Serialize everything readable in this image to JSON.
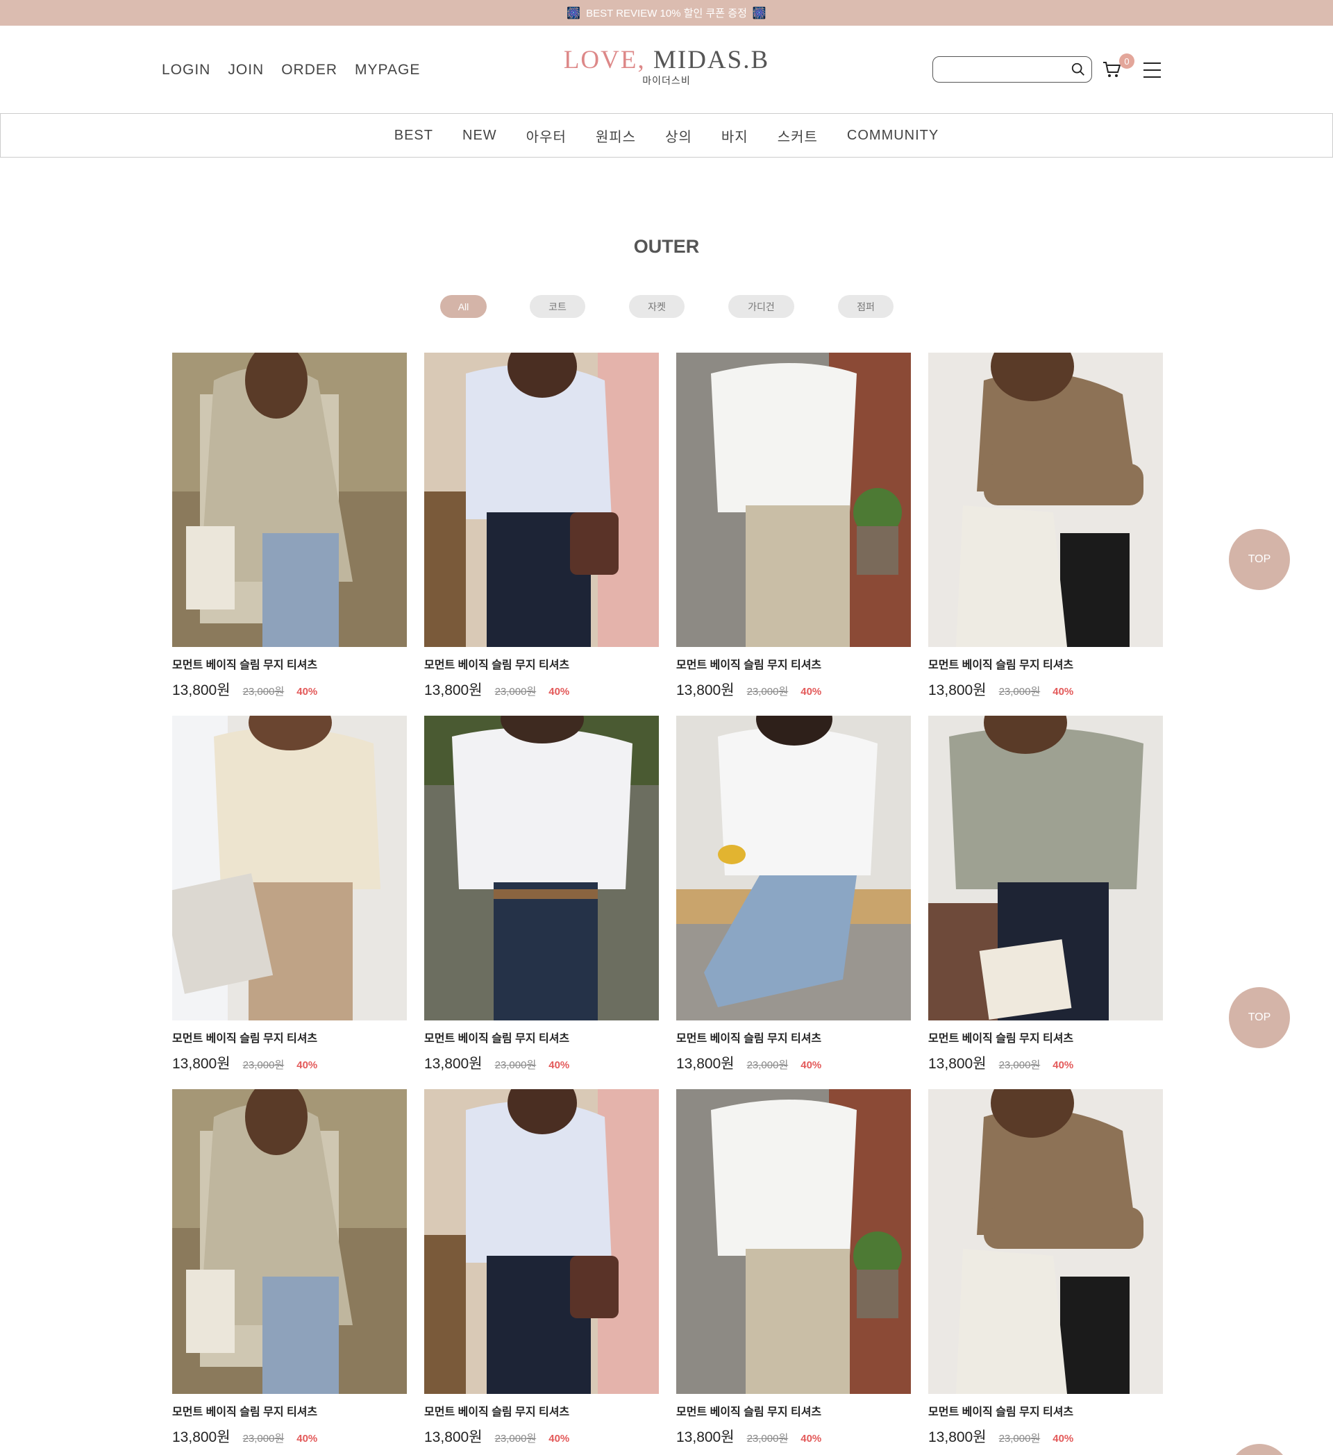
{
  "promo": {
    "text": "BEST REVIEW 10% 할인 쿠폰 증정",
    "spark_left": "🎆",
    "spark_right": "🎆"
  },
  "header": {
    "util_links": [
      "LOGIN",
      "JOIN",
      "ORDER",
      "MYPAGE"
    ],
    "logo_accent": "LOVE,",
    "logo_main": "MIDAS.B",
    "logo_sub": "마이더스비",
    "search_placeholder": "",
    "cart_count": "0"
  },
  "nav": [
    "BEST",
    "NEW",
    "아우터",
    "원피스",
    "상의",
    "바지",
    "스커트",
    "COMMUNITY"
  ],
  "category_title": "OUTER",
  "filters": [
    {
      "label": "All",
      "active": true
    },
    {
      "label": "코트",
      "active": false
    },
    {
      "label": "자켓",
      "active": false
    },
    {
      "label": "가디건",
      "active": false
    },
    {
      "label": "점퍼",
      "active": false
    }
  ],
  "products": [
    {
      "name": "모먼트 베이직 슬림 무지 티셔츠",
      "price": "13,800원",
      "orig": "23,000원",
      "disc": "40%",
      "photo": "beige-shirt-tote"
    },
    {
      "name": "모먼트 베이직 슬림 무지 티셔츠",
      "price": "13,800원",
      "orig": "23,000원",
      "disc": "40%",
      "photo": "blue-blouse-bag"
    },
    {
      "name": "모먼트 베이직 슬림 무지 티셔츠",
      "price": "13,800원",
      "orig": "23,000원",
      "disc": "40%",
      "photo": "white-shirt-crossbody"
    },
    {
      "name": "모먼트 베이직 슬림 무지 티셔츠",
      "price": "13,800원",
      "orig": "23,000원",
      "disc": "40%",
      "photo": "brown-knit-ecobag"
    },
    {
      "name": "모먼트 베이직 슬림 무지 티셔츠",
      "price": "13,800원",
      "orig": "23,000원",
      "disc": "40%",
      "photo": "cream-shirt-book"
    },
    {
      "name": "모먼트 베이직 슬림 무지 티셔츠",
      "price": "13,800원",
      "orig": "23,000원",
      "disc": "40%",
      "photo": "white-tee-print"
    },
    {
      "name": "모먼트 베이직 슬림 무지 티셔츠",
      "price": "13,800원",
      "orig": "23,000원",
      "disc": "40%",
      "photo": "white-blouse-jeans"
    },
    {
      "name": "모먼트 베이직 슬림 무지 티셔츠",
      "price": "13,800원",
      "orig": "23,000원",
      "disc": "40%",
      "photo": "stripe-shirt-book"
    },
    {
      "name": "모먼트 베이직 슬림 무지 티셔츠",
      "price": "13,800원",
      "orig": "23,000원",
      "disc": "40%",
      "photo": "beige-shirt-tote"
    },
    {
      "name": "모먼트 베이직 슬림 무지 티셔츠",
      "price": "13,800원",
      "orig": "23,000원",
      "disc": "40%",
      "photo": "blue-blouse-bag"
    },
    {
      "name": "모먼트 베이직 슬림 무지 티셔츠",
      "price": "13,800원",
      "orig": "23,000원",
      "disc": "40%",
      "photo": "white-shirt-crossbody"
    },
    {
      "name": "모먼트 베이직 슬림 무지 티셔츠",
      "price": "13,800원",
      "orig": "23,000원",
      "disc": "40%",
      "photo": "brown-knit-ecobag"
    }
  ],
  "top_button_label": "TOP",
  "colors": {
    "promo": "#dbbcb0",
    "accent": "#d4b4a8",
    "discount": "#e35a5a",
    "logo_accent": "#dd8888"
  }
}
